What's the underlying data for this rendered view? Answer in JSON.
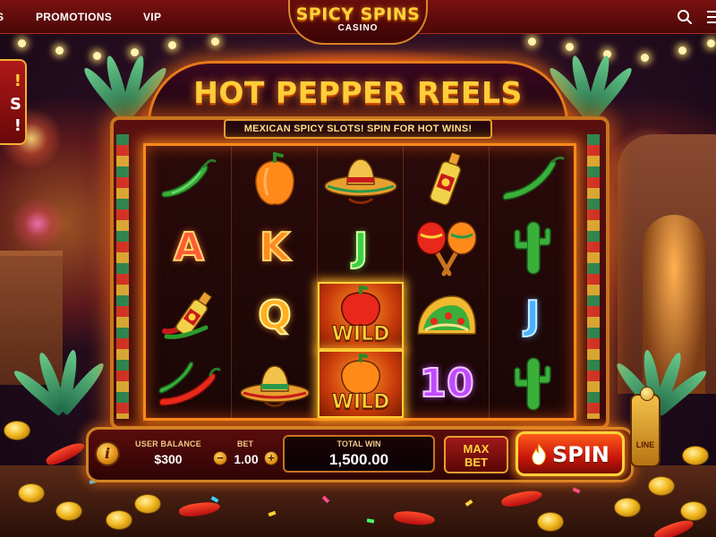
{
  "nav": {
    "partial_item": "S",
    "promotions": "PROMOTIONS",
    "vip": "VIP",
    "brand_main": "SPICY SPINS",
    "brand_sub": "CASINO",
    "search_icon": "search-icon"
  },
  "promo_banner": {
    "line1": "!",
    "line2": "S",
    "line3": "!"
  },
  "game": {
    "title": "HOT PEPPER REELS",
    "subtitle": "MEXICAN SPICY SLOTS! SPIN FOR HOT WINS!",
    "reels": [
      [
        "green-chili",
        "A",
        "tequila-bottle",
        "chili-pair"
      ],
      [
        "orange-pepper",
        "K",
        "Q",
        "sombrero"
      ],
      [
        "sombrero",
        "J",
        "wild-red-pepper",
        "wild-orange-pepper"
      ],
      [
        "tequila-bottle",
        "maracas",
        "taco",
        "10"
      ],
      [
        "green-chili",
        "cactus",
        "J",
        "cactus"
      ]
    ],
    "wild_label": "WILD",
    "letters": {
      "A": "A",
      "K": "K",
      "J": "J",
      "Q": "Q",
      "ten": "10",
      "J2": "J"
    }
  },
  "controls": {
    "info_label": "i",
    "balance_label": "USER BALANCE",
    "balance_value": "$300",
    "bet_label": "BET",
    "bet_value": "1.00",
    "bet_minus": "−",
    "bet_plus": "+",
    "total_win_label": "TOTAL WIN",
    "total_win_value": "1,500.00",
    "max_bet_line1": "MAX",
    "max_bet_line2": "BET",
    "spin_label": "SPIN",
    "line_label": "LINE"
  },
  "colors": {
    "accent_gold": "#ffd23a",
    "flame_orange": "#ff8a1a",
    "deep_red": "#5a0c0c"
  }
}
